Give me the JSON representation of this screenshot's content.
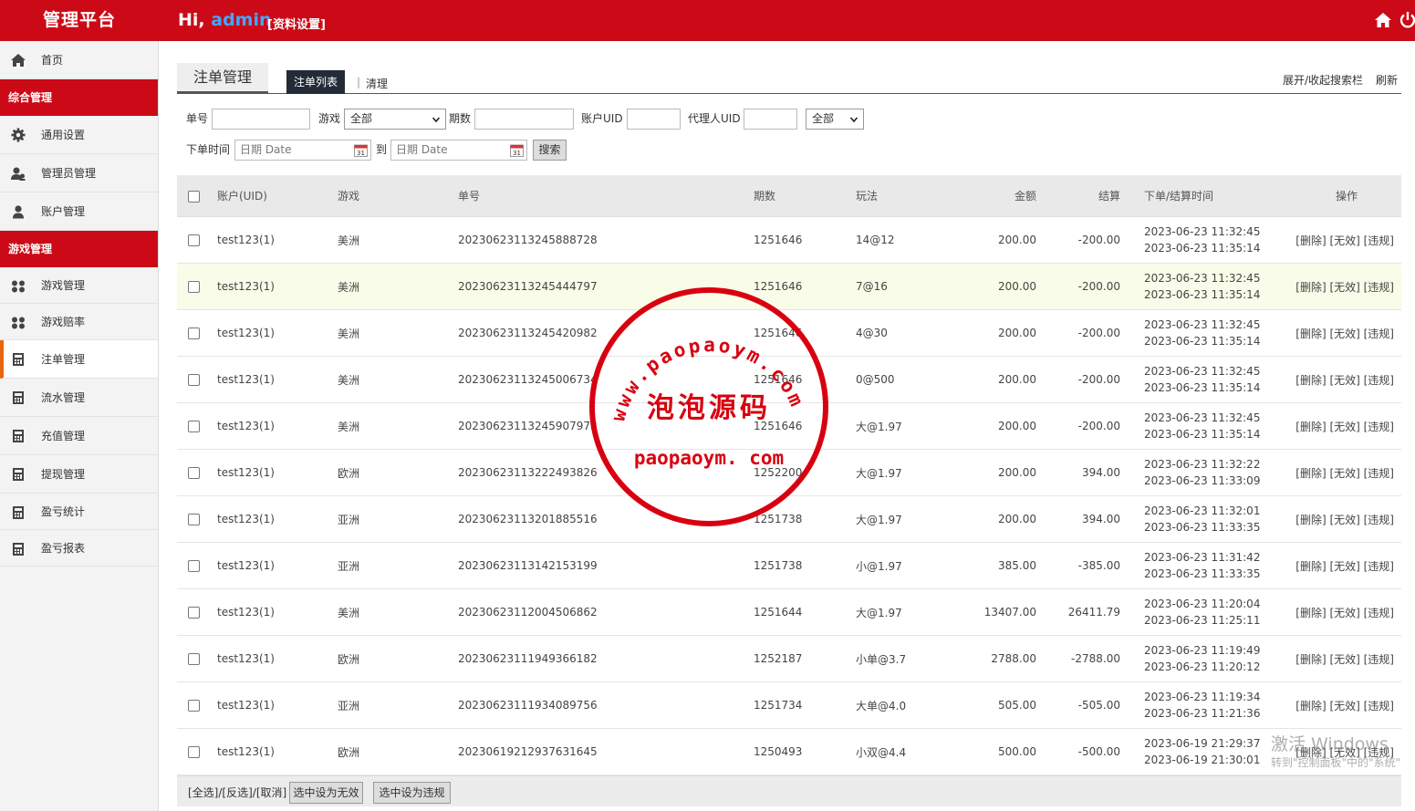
{
  "header": {
    "brand": "管理平台",
    "greeting_prefix": "Hi, ",
    "username": "admin",
    "profile_link": "[资料设置]"
  },
  "sidebar": {
    "home": "首页",
    "group1": "综合管理",
    "general_settings": "通用设置",
    "admin_mgmt": "管理员管理",
    "account_mgmt": "账户管理",
    "group2": "游戏管理",
    "game_mgmt": "游戏管理",
    "game_odds": "游戏赔率",
    "bet_mgmt": "注单管理",
    "flow_mgmt": "流水管理",
    "recharge_mgmt": "充值管理",
    "withdraw_mgmt": "提现管理",
    "profit_stats": "盈亏统计",
    "profit_report": "盈亏报表"
  },
  "tabs": {
    "title": "注单管理",
    "list": "注单列表",
    "separator": "|",
    "clear": "清理",
    "toggle_search": "展开/收起搜索栏",
    "refresh": "刷新"
  },
  "filters": {
    "order_no_label": "单号",
    "game_label": "游戏",
    "game_value": "全部",
    "issue_label": "期数",
    "uid_label": "账户UID",
    "agent_uid_label": "代理人UID",
    "status_value": "全部",
    "time_label": "下单时间",
    "date_placeholder_from": "日期 Date",
    "to_label": "到",
    "date_placeholder_to": "日期 Date",
    "search_button": "搜索"
  },
  "table": {
    "headers": {
      "account": "账户(UID)",
      "game": "游戏",
      "order_no": "单号",
      "issue": "期数",
      "play": "玩法",
      "amount": "金额",
      "settle": "结算",
      "time": "下单/结算时间",
      "actions": "操作"
    },
    "actions_text": "[删除] [无效] [违规]",
    "rows": [
      {
        "account": "test123(1)",
        "game": "美洲",
        "order_no": "20230623113245888728",
        "issue": "1251646",
        "play": "14@12",
        "amount": "200.00",
        "settle": "-200.00",
        "t1": "2023-06-23 11:32:45",
        "t2": "2023-06-23 11:35:14"
      },
      {
        "account": "test123(1)",
        "game": "美洲",
        "order_no": "20230623113245444797",
        "issue": "1251646",
        "play": "7@16",
        "amount": "200.00",
        "settle": "-200.00",
        "t1": "2023-06-23 11:32:45",
        "t2": "2023-06-23 11:35:14"
      },
      {
        "account": "test123(1)",
        "game": "美洲",
        "order_no": "20230623113245420982",
        "issue": "1251646",
        "play": "4@30",
        "amount": "200.00",
        "settle": "-200.00",
        "t1": "2023-06-23 11:32:45",
        "t2": "2023-06-23 11:35:14"
      },
      {
        "account": "test123(1)",
        "game": "美洲",
        "order_no": "20230623113245006734",
        "issue": "1251646",
        "play": "0@500",
        "amount": "200.00",
        "settle": "-200.00",
        "t1": "2023-06-23 11:32:45",
        "t2": "2023-06-23 11:35:14"
      },
      {
        "account": "test123(1)",
        "game": "美洲",
        "order_no": "20230623113245907978",
        "issue": "1251646",
        "play": "大@1.97",
        "amount": "200.00",
        "settle": "-200.00",
        "t1": "2023-06-23 11:32:45",
        "t2": "2023-06-23 11:35:14"
      },
      {
        "account": "test123(1)",
        "game": "欧洲",
        "order_no": "20230623113222493826",
        "issue": "1252200",
        "play": "大@1.97",
        "amount": "200.00",
        "settle": "394.00",
        "t1": "2023-06-23 11:32:22",
        "t2": "2023-06-23 11:33:09"
      },
      {
        "account": "test123(1)",
        "game": "亚洲",
        "order_no": "20230623113201885516",
        "issue": "1251738",
        "play": "大@1.97",
        "amount": "200.00",
        "settle": "394.00",
        "t1": "2023-06-23 11:32:01",
        "t2": "2023-06-23 11:33:35"
      },
      {
        "account": "test123(1)",
        "game": "亚洲",
        "order_no": "20230623113142153199",
        "issue": "1251738",
        "play": "小@1.97",
        "amount": "385.00",
        "settle": "-385.00",
        "t1": "2023-06-23 11:31:42",
        "t2": "2023-06-23 11:33:35"
      },
      {
        "account": "test123(1)",
        "game": "美洲",
        "order_no": "20230623112004506862",
        "issue": "1251644",
        "play": "大@1.97",
        "amount": "13407.00",
        "settle": "26411.79",
        "t1": "2023-06-23 11:20:04",
        "t2": "2023-06-23 11:25:11"
      },
      {
        "account": "test123(1)",
        "game": "欧洲",
        "order_no": "20230623111949366182",
        "issue": "1252187",
        "play": "小单@3.7",
        "amount": "2788.00",
        "settle": "-2788.00",
        "t1": "2023-06-23 11:19:49",
        "t2": "2023-06-23 11:20:12"
      },
      {
        "account": "test123(1)",
        "game": "亚洲",
        "order_no": "20230623111934089756",
        "issue": "1251734",
        "play": "大单@4.0",
        "amount": "505.00",
        "settle": "-505.00",
        "t1": "2023-06-23 11:19:34",
        "t2": "2023-06-23 11:21:36"
      },
      {
        "account": "test123(1)",
        "game": "欧洲",
        "order_no": "20230619212937631645",
        "issue": "1250493",
        "play": "小双@4.4",
        "amount": "500.00",
        "settle": "-500.00",
        "t1": "2023-06-19 21:29:37",
        "t2": "2023-06-19 21:30:01"
      }
    ]
  },
  "footer": {
    "select_links": "[全选]/[反选]/[取消]",
    "mark_invalid": "选中设为无效",
    "mark_violation": "选中设为违规"
  },
  "stamp": {
    "top_arc": "www.paopaoym.com",
    "center": "泡泡源码",
    "bottom": "paopaoym. com"
  },
  "os_watermark": {
    "line1": "激活 Windows",
    "line2": "转到\"控制面板\"中的\"系统\""
  },
  "colors": {
    "brand_red": "#cc0a17",
    "username_blue": "#3fa9ff",
    "active_accent": "#e8660d",
    "tab_dark": "#222b36",
    "row_highlight": "#f8fce8"
  }
}
